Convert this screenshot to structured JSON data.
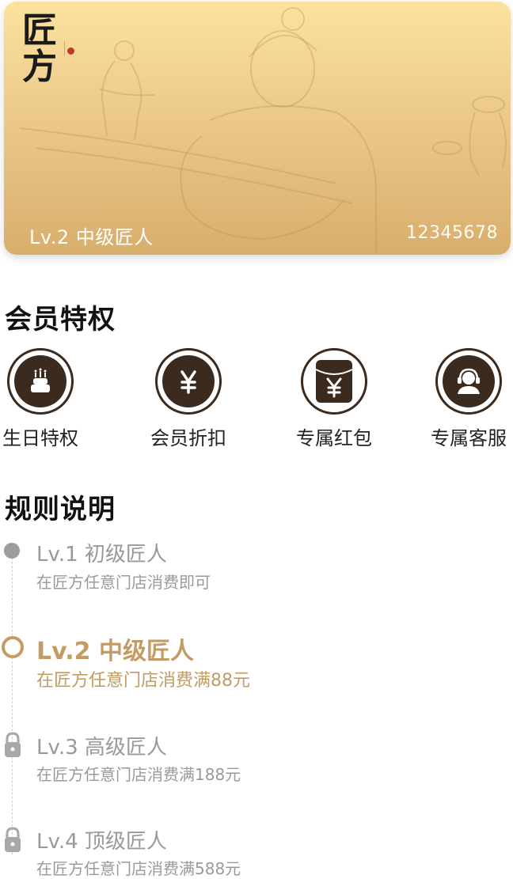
{
  "card": {
    "logo_text": "匠方",
    "level": "Lv.2 中级匠人",
    "member_number": "12345678"
  },
  "privileges": {
    "title": "会员特权",
    "items": [
      {
        "label": "生日特权",
        "icon": "cake-icon"
      },
      {
        "label": "会员折扣",
        "icon": "yen-coin-icon"
      },
      {
        "label": "专属红包",
        "icon": "red-envelope-icon"
      },
      {
        "label": "专属客服",
        "icon": "customer-service-icon"
      }
    ]
  },
  "rules": {
    "title": "规则说明",
    "levels": [
      {
        "title": "Lv.1 初级匠人",
        "desc": "在匠方任意门店消费即可",
        "state": "achieved"
      },
      {
        "title": "Lv.2 中级匠人",
        "desc": "在匠方任意门店消费满88元",
        "state": "current"
      },
      {
        "title": "Lv.3 高级匠人",
        "desc": "在匠方任意门店消费满188元",
        "state": "locked"
      },
      {
        "title": "Lv.4 顶级匠人",
        "desc": "在匠方任意门店消费满588元",
        "state": "locked"
      }
    ]
  },
  "colors": {
    "accent_gold": "#c49b62",
    "icon_brown": "#3b2a1e",
    "muted_gray": "#999999"
  }
}
